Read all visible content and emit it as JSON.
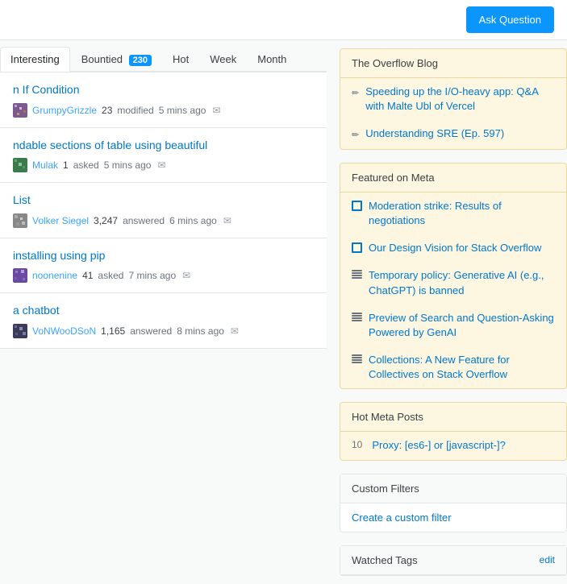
{
  "header": {
    "ask_button_label": "Ask Question"
  },
  "tabs": {
    "items": [
      {
        "id": "interesting",
        "label": "Interesting",
        "active": true,
        "badge": null
      },
      {
        "id": "bountied",
        "label": "Bountied",
        "active": false,
        "badge": "230"
      },
      {
        "id": "hot",
        "label": "Hot",
        "active": false,
        "badge": null
      },
      {
        "id": "week",
        "label": "Week",
        "active": false,
        "badge": null
      },
      {
        "id": "month",
        "label": "Month",
        "active": false,
        "badge": null
      }
    ]
  },
  "questions": [
    {
      "id": 1,
      "title": "n If Condition",
      "user": "GrumpyGrizzle",
      "user_rep": "23",
      "action": "modified",
      "time": "5 mins ago",
      "avatar_color": "purple"
    },
    {
      "id": 2,
      "title": "ndable sections of table using beautiful",
      "user": "Mulak",
      "user_rep": "1",
      "action": "asked",
      "time": "5 mins ago",
      "avatar_color": "green"
    },
    {
      "id": 3,
      "title": "List",
      "user": "Volker Siegel",
      "user_rep": "3,247",
      "action": "answered",
      "time": "6 mins ago",
      "avatar_color": "gray"
    },
    {
      "id": 4,
      "title": "installing using pip",
      "user": "noonenine",
      "user_rep": "41",
      "action": "asked",
      "time": "7 mins ago",
      "avatar_color": "purple2"
    },
    {
      "id": 5,
      "title": "a chatbot",
      "user": "VoNWooDSoN",
      "user_rep": "1,165",
      "action": "answered",
      "time": "8 mins ago",
      "avatar_color": "dark"
    }
  ],
  "sidebar": {
    "blog": {
      "header": "The Overflow Blog",
      "items": [
        {
          "text": "Speeding up the I/O-heavy app: Q&A with Malte Ubl of Vercel",
          "type": "pencil"
        },
        {
          "text": "Understanding SRE (Ep. 597)",
          "type": "pencil"
        }
      ]
    },
    "featured": {
      "header": "Featured on Meta",
      "items": [
        {
          "text": "Moderation strike: Results of negotiations",
          "type": "square"
        },
        {
          "text": "Our Design Vision for Stack Overflow",
          "type": "square"
        },
        {
          "text": "Temporary policy: Generative AI (e.g., ChatGPT) is banned",
          "type": "stack"
        },
        {
          "text": "Preview of Search and Question-Asking Powered by GenAI",
          "type": "stack"
        },
        {
          "text": "Collections: A New Feature for Collectives on Stack Overflow",
          "type": "stack"
        }
      ]
    },
    "hot_meta": {
      "header": "Hot Meta Posts",
      "items": [
        {
          "number": "10",
          "text": "Proxy: [es6-] or [javascript-]?"
        }
      ]
    },
    "custom_filters": {
      "header": "Custom Filters",
      "create_link": "Create a custom filter"
    },
    "watched_tags": {
      "header": "Watched Tags",
      "edit_label": "edit"
    }
  }
}
